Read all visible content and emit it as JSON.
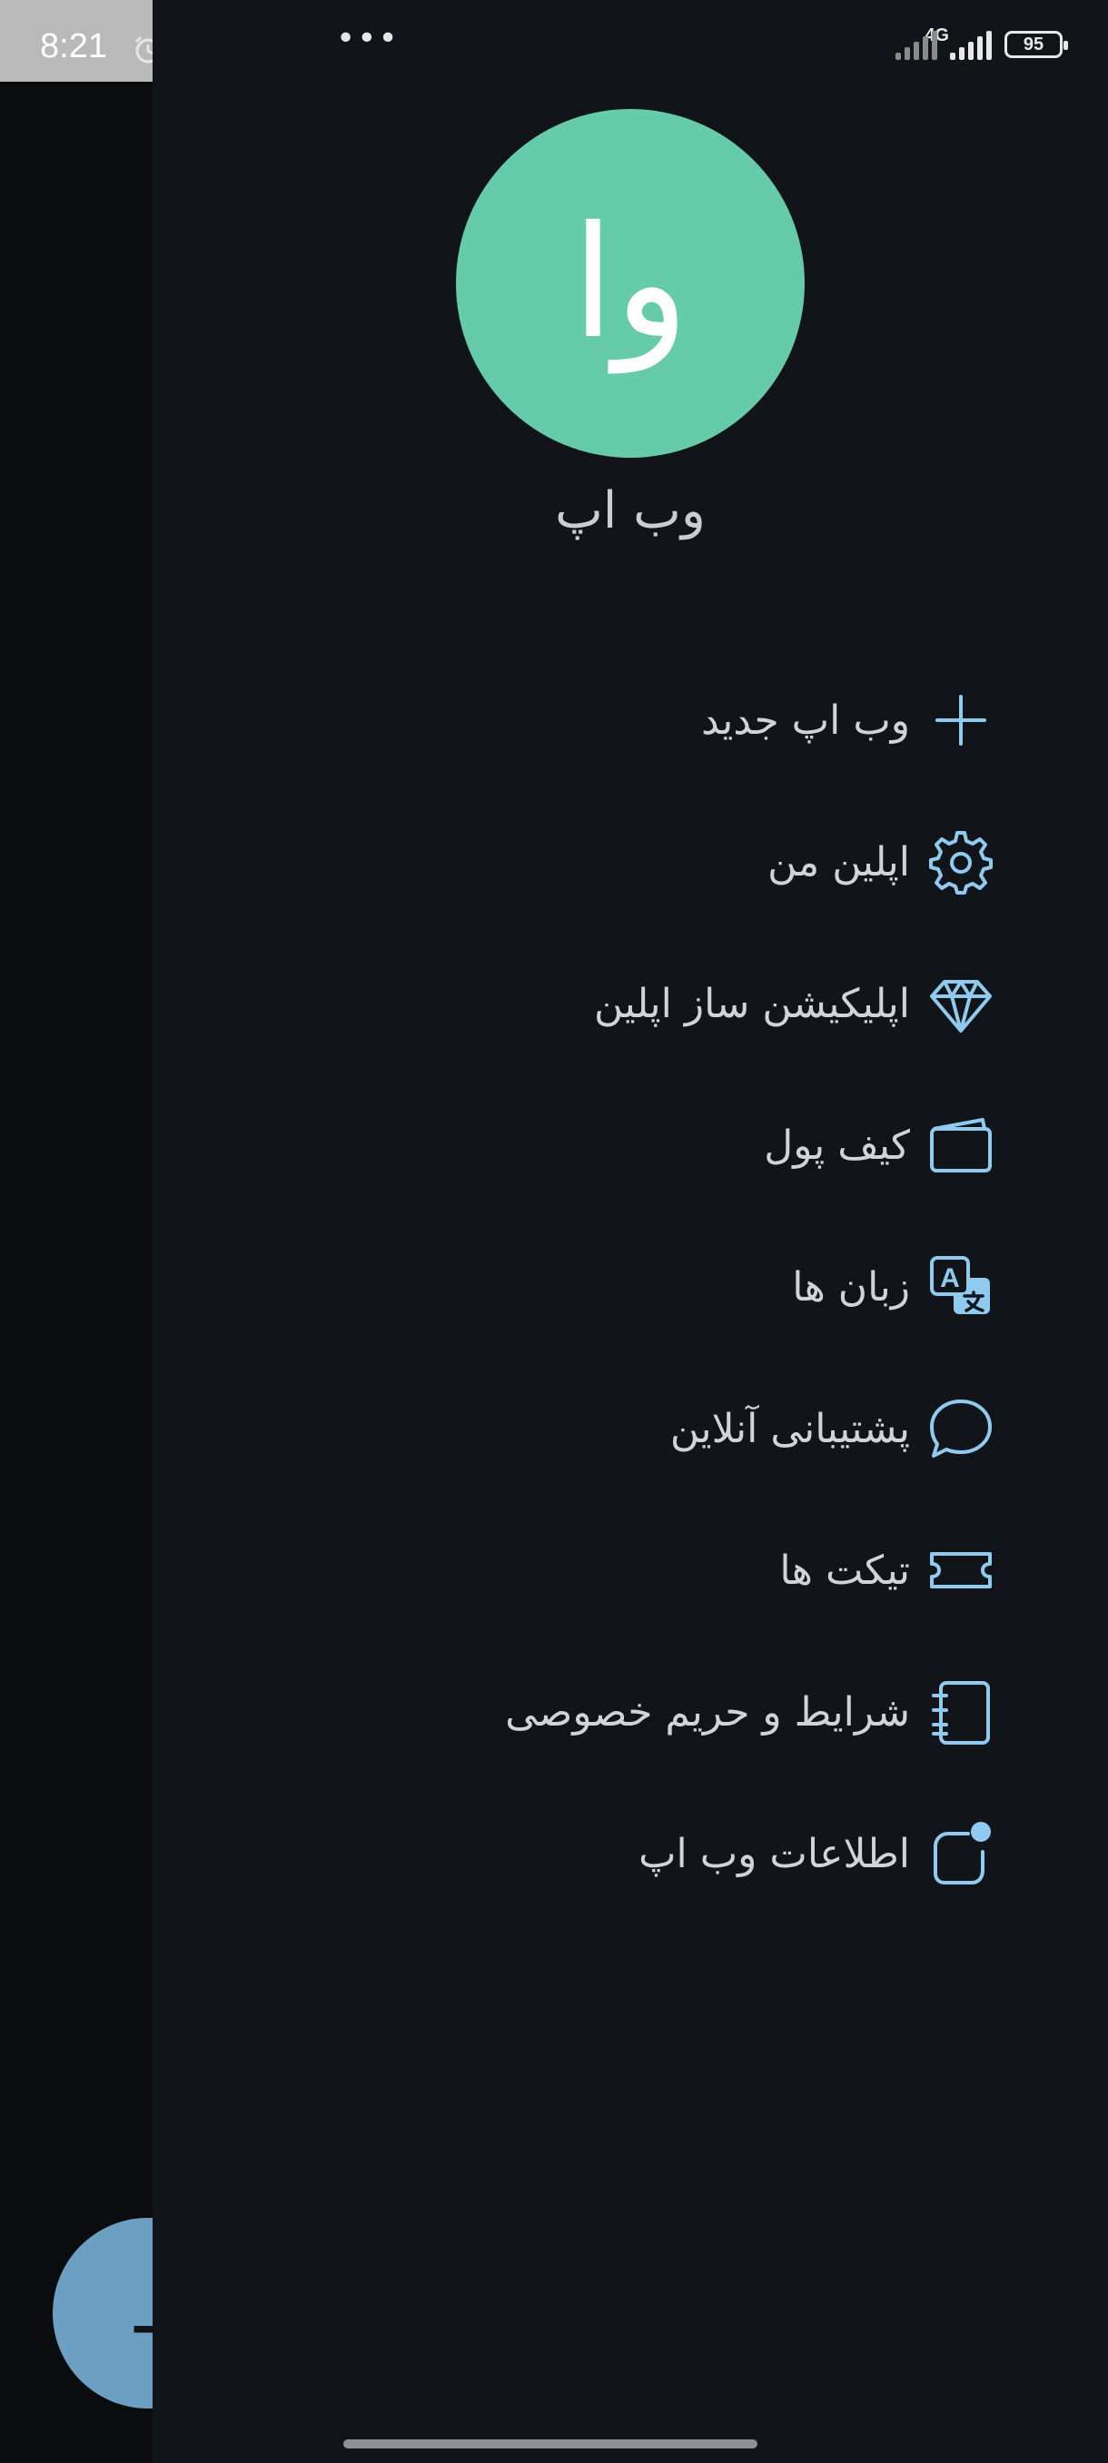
{
  "status_bar": {
    "time": "8:21",
    "network": "4G",
    "battery": "95"
  },
  "drawer": {
    "avatar_initials": "وا",
    "app_name": "وب اپ",
    "menu": [
      {
        "label": "وب اپ جدید",
        "icon": "plus-icon"
      },
      {
        "label": "اپلین من",
        "icon": "gear-icon"
      },
      {
        "label": "اپلیکیشن ساز اپلین",
        "icon": "diamond-icon"
      },
      {
        "label": "کیف پول",
        "icon": "wallet-icon"
      },
      {
        "label": "زبان ها",
        "icon": "translate-icon"
      },
      {
        "label": "پشتیبانی آنلاین",
        "icon": "chat-bubble-icon"
      },
      {
        "label": "تیکت ها",
        "icon": "ticket-icon"
      },
      {
        "label": "شرایط و حریم خصوصی",
        "icon": "notebook-icon"
      },
      {
        "label": "اطلاعات وب اپ",
        "icon": "info-notification-icon"
      }
    ]
  },
  "colors": {
    "accent": "#8ecbef",
    "avatar_bg": "#65cba9",
    "drawer_bg": "#111519",
    "fab": "#6c9fc2"
  }
}
